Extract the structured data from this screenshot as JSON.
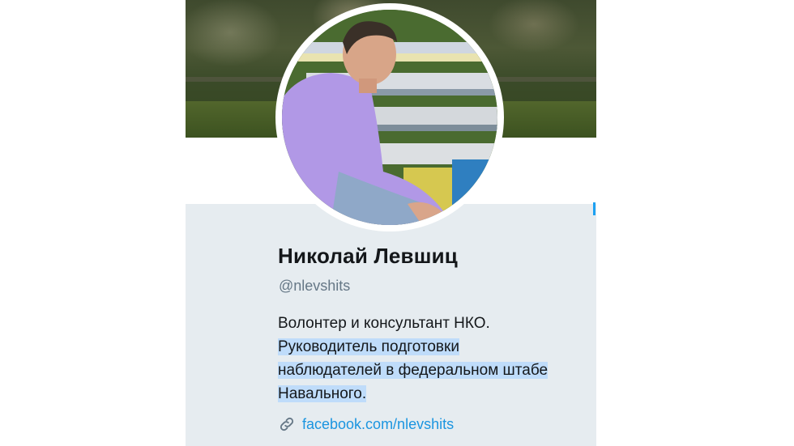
{
  "profile": {
    "name": "Николай Левшиц",
    "handle": "@nlevshits",
    "bio_lines": [
      "Волонтер и консультант НКО.",
      "Руководитель подготовки",
      "наблюдателей в федеральном штабе",
      "Навального."
    ],
    "link_icon": "link-icon",
    "link": "facebook.com/nlevshits"
  },
  "colors": {
    "info_background": "#e6ecf0",
    "link": "#1b95e0",
    "selection_highlight": "#bfdcfa",
    "name": "#14171a",
    "handle": "#657786"
  }
}
